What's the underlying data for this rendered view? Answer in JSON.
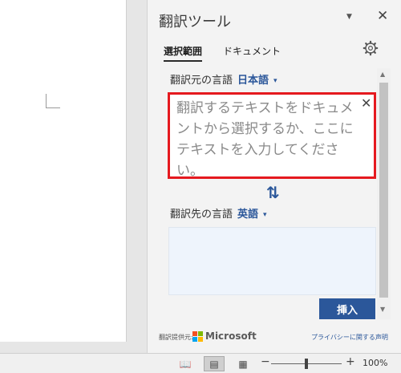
{
  "pane": {
    "title": "翻訳ツール",
    "dropdown_icon": "▼",
    "close_icon": "✕"
  },
  "tabs": [
    {
      "label": "選択範囲",
      "selected": true
    },
    {
      "label": "ドキュメント",
      "selected": false
    }
  ],
  "source": {
    "label": "翻訳元の言語",
    "language": "日本語",
    "caret": "▾",
    "placeholder": "翻訳するテキストをドキュメントから選択するか、ここにテキストを入力してください。",
    "clear_icon": "✕"
  },
  "swap_icon": "⇅",
  "target": {
    "label": "翻訳先の言語",
    "language": "英語",
    "caret": "▾"
  },
  "insert_label": "挿入",
  "footer": {
    "provider_label": "翻訳提供元:",
    "provider": "Microsoft",
    "privacy_link": "プライバシーに関する声明"
  },
  "scrollbar": {
    "up": "▲",
    "down": "▼"
  },
  "statusbar": {
    "read_mode_icon": "📖",
    "print_layout_icon": "▤",
    "web_layout_icon": "▦",
    "zoom_minus": "−",
    "zoom_plus": "+",
    "zoom": "100%"
  },
  "colors": {
    "accent": "#2b579a",
    "highlight": "#e5191f",
    "ms_red": "#f25022",
    "ms_green": "#7fba00",
    "ms_blue": "#00a4ef",
    "ms_yellow": "#ffb900"
  }
}
